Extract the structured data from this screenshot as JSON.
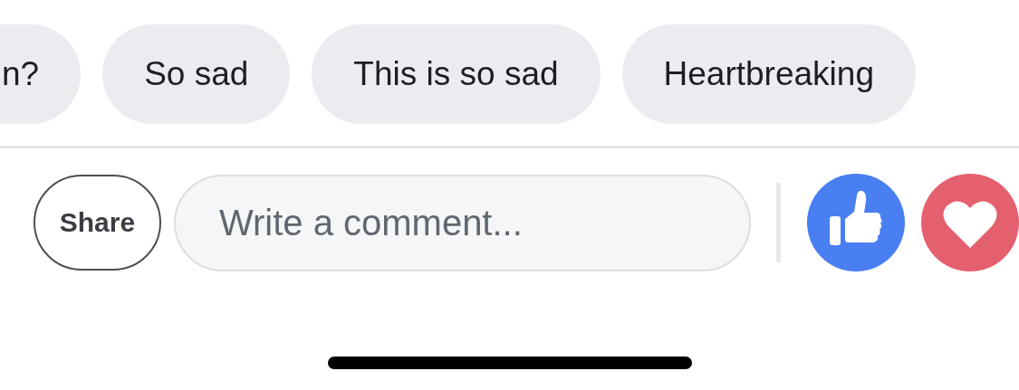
{
  "suggestions": [
    {
      "label": "n?"
    },
    {
      "label": "So sad"
    },
    {
      "label": "This is so sad"
    },
    {
      "label": "Heartbreaking"
    }
  ],
  "share_button": {
    "label": "Share"
  },
  "comment_field": {
    "placeholder": "Write a comment..."
  },
  "reactions": [
    {
      "kind": "like"
    },
    {
      "kind": "love"
    }
  ]
}
